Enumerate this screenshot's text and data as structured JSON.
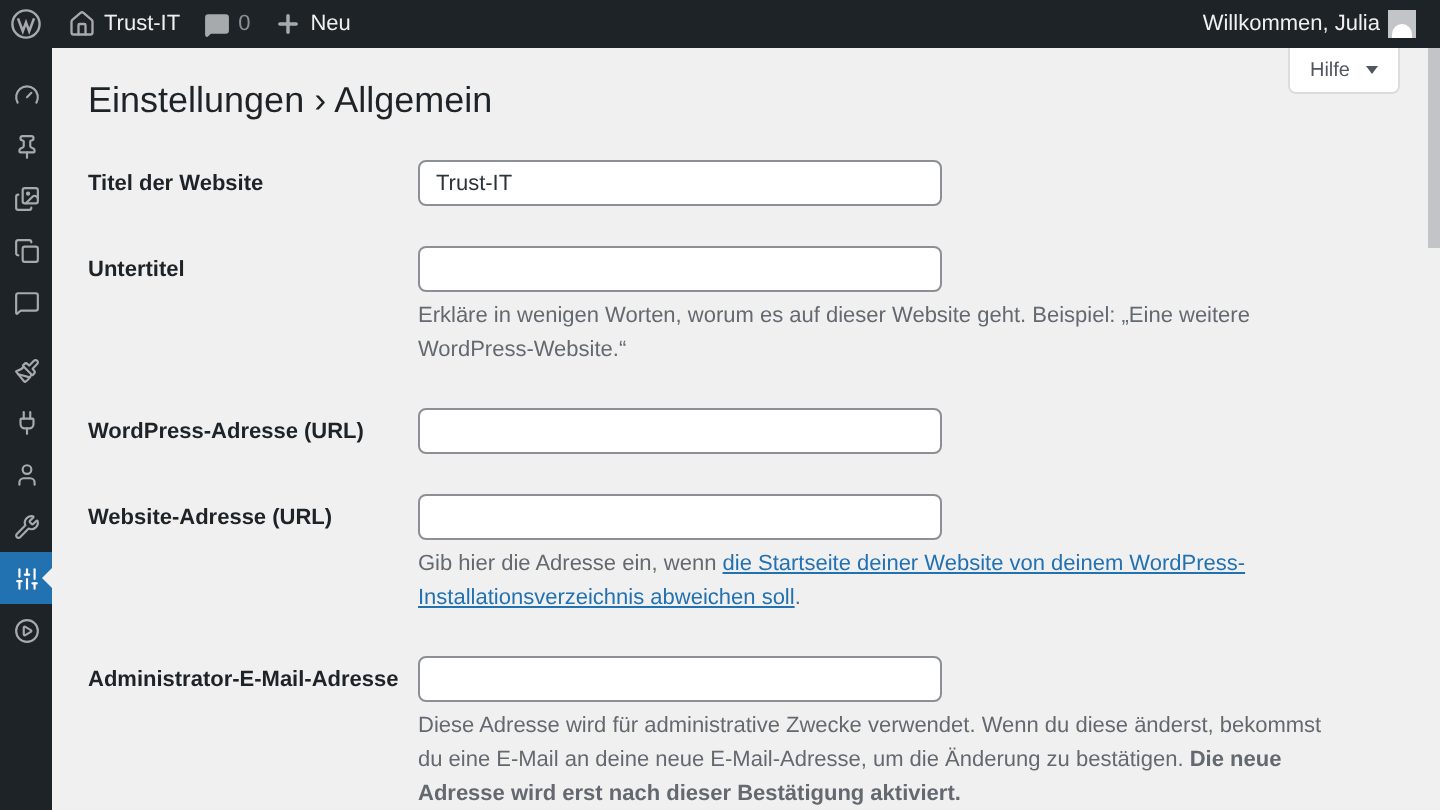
{
  "admin_bar": {
    "site_name": "Trust-IT",
    "comments_count": "0",
    "new_label": "Neu",
    "greeting": "Willkommen, Julia"
  },
  "sidebar": {
    "items": [
      {
        "kind": "dashboard",
        "selected": false
      },
      {
        "kind": "posts",
        "selected": false
      },
      {
        "kind": "media",
        "selected": false
      },
      {
        "kind": "pages",
        "selected": false
      },
      {
        "kind": "comments",
        "selected": false
      },
      {
        "kind": "appearance",
        "selected": false
      },
      {
        "kind": "plugins",
        "selected": false
      },
      {
        "kind": "users",
        "selected": false
      },
      {
        "kind": "tools",
        "selected": false
      },
      {
        "kind": "settings",
        "selected": true
      },
      {
        "kind": "media-play",
        "selected": false
      }
    ]
  },
  "help_button": "Hilfe",
  "page_title": "Einstellungen › Allgemein",
  "fields": [
    {
      "label": "Titel der Website",
      "value": "Trust-IT"
    },
    {
      "label": "Untertitel",
      "description": {
        "text": "Erkläre in wenigen Worten, worum es auf dieser Website geht. Beispiel: „Eine weitere WordPress-Website.“"
      }
    },
    {
      "label": "WordPress-Adresse (URL)"
    },
    {
      "label": "Website-Adresse (URL)",
      "description": {
        "text": "Gib hier die Adresse ein, wenn ",
        "link": [
          "die Startseite deiner Website von deinem WordPress-",
          "Installationsverzeichnis abweichen soll"
        ],
        "after": "."
      }
    },
    {
      "label": "Administrator-E-Mail-Adresse",
      "description": {
        "text": "Diese Adresse wird für administrative Zwecke verwendet. Wenn du diese änderst, bekommst du eine E-Mail an deine neue E-Mail-Adresse, um die Änderung zu bestätigen. **Die neue Adresse wird erst nach dieser Bestätigung aktiviert.**"
      }
    }
  ]
}
